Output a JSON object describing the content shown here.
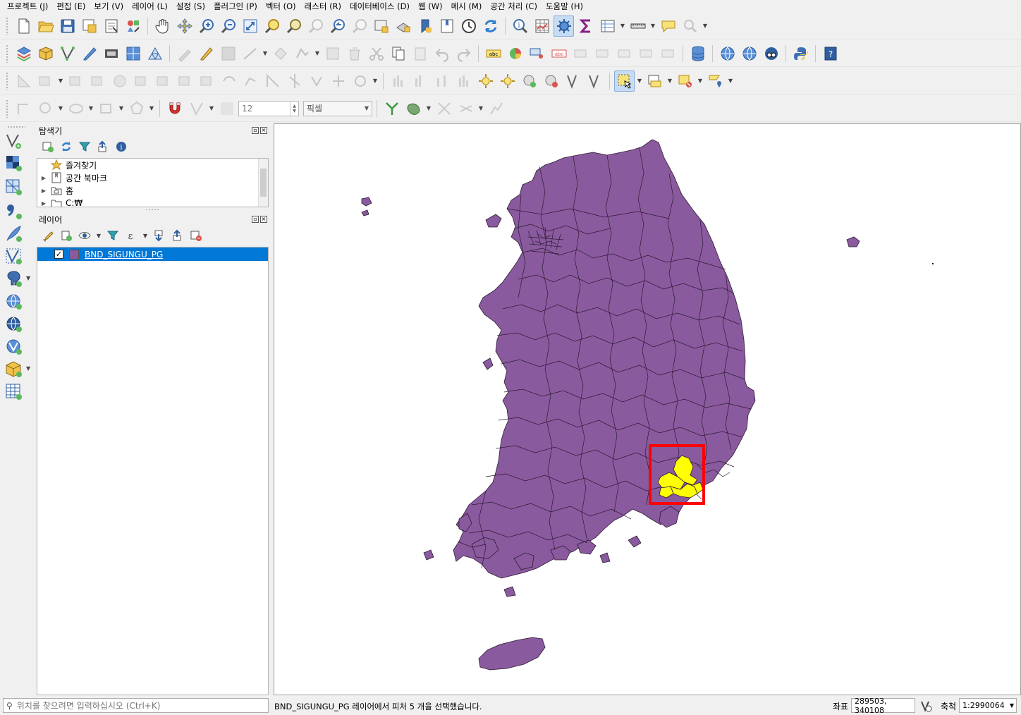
{
  "menu": [
    "프로젝트 (J)",
    "편집 (E)",
    "보기 (V)",
    "레이어 (L)",
    "설정 (S)",
    "플러그인 (P)",
    "벡터 (O)",
    "래스터 (R)",
    "데이터베이스 (D)",
    "웹 (W)",
    "메시 (M)",
    "공간 처리 (C)",
    "도움말 (H)"
  ],
  "digitizing": {
    "tolerance_value": "12",
    "unit": "픽셀"
  },
  "browser_panel": {
    "title": "탐색기",
    "items": [
      {
        "label": "즐겨찾기",
        "icon": "star-icon",
        "expandable": false
      },
      {
        "label": "공간 북마크",
        "icon": "bookmark-icon",
        "expandable": true
      },
      {
        "label": "홈",
        "icon": "home-folder-icon",
        "expandable": true
      },
      {
        "label": "C:₩",
        "icon": "drive-folder-icon",
        "expandable": true
      }
    ]
  },
  "layers_panel": {
    "title": "레이어",
    "layers": [
      {
        "name": "BND_SIGUNGU_PG",
        "checked": true,
        "color": "#8a5a9e"
      }
    ]
  },
  "map": {
    "fill_color": "#8a5a9e",
    "selection_color": "#ffff00",
    "highlight_box_color": "#ff0000"
  },
  "status": {
    "locator_placeholder": "위치를 찾으려면 입력하십시오 (Ctrl+K)",
    "message": "BND_SIGUNGU_PG 레이어에서 피처 5 개을 선택했습니다.",
    "coord_label": "좌표",
    "coord_value": "289503, 340108",
    "scale_label": "축척",
    "scale_value": "1:2990064"
  }
}
